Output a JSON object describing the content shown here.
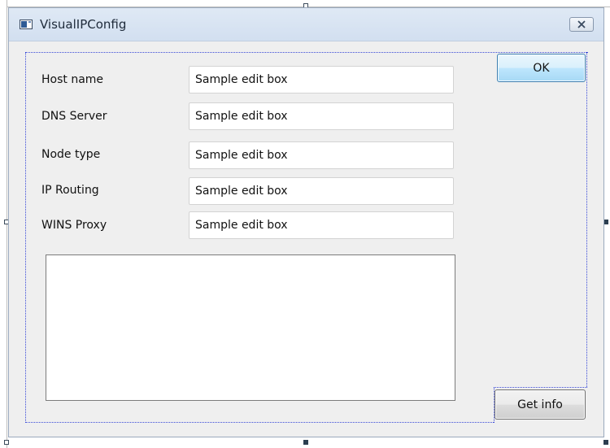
{
  "window": {
    "title": "VisualIPConfig"
  },
  "fields": [
    {
      "label": "Host name",
      "value": "Sample edit box"
    },
    {
      "label": "DNS Server",
      "value": "Sample edit box"
    },
    {
      "label": "Node type",
      "value": "Sample edit box"
    },
    {
      "label": "IP Routing",
      "value": "Sample edit box"
    },
    {
      "label": "WINS Proxy",
      "value": "Sample edit box"
    }
  ],
  "buttons": {
    "ok": "OK",
    "get_info": "Get info"
  },
  "icons": {
    "app": "app-window-icon",
    "close": "close-icon"
  },
  "colors": {
    "titlebar": "#d2dff0",
    "dialog_bg": "#efefef",
    "focus_dots": "#3a4ad8",
    "ok_border": "#3c7fb1"
  }
}
